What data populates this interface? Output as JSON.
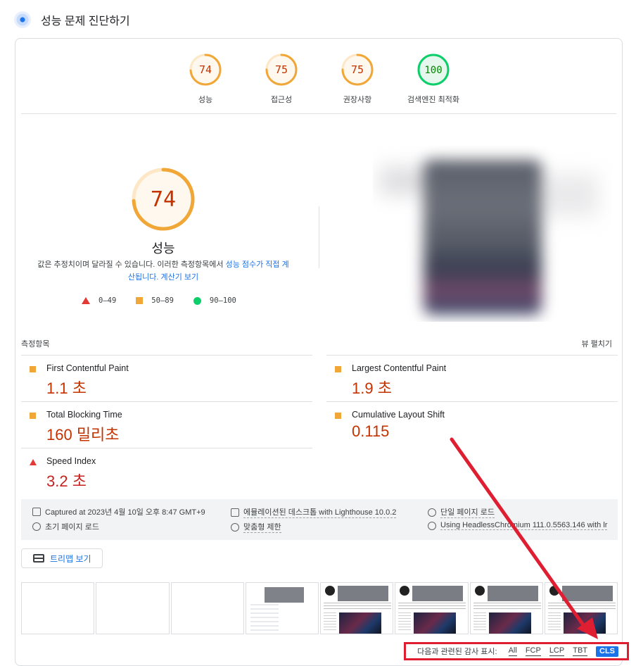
{
  "header": {
    "title": "성능 문제 진단하기",
    "icon": "lighthouse-icon"
  },
  "categories": [
    {
      "score": 74,
      "label": "성능",
      "color": "#f0a737",
      "fill": "#fff8ee",
      "text_color": "#c33300"
    },
    {
      "score": 75,
      "label": "접근성",
      "color": "#f0a737",
      "fill": "#fff8ee",
      "text_color": "#c33300"
    },
    {
      "score": 75,
      "label": "권장사항",
      "color": "#f0a737",
      "fill": "#fff8ee",
      "text_color": "#c33300"
    },
    {
      "score": 100,
      "label": "검색엔진 최적화",
      "color": "#0cce6b",
      "fill": "#e6f7ee",
      "text_color": "#008800"
    }
  ],
  "performance": {
    "score": 74,
    "label": "성능",
    "desc_1": "값은 추정치이며 달라질 수 있습니다. 이러한 측정항목에서 ",
    "desc_link1": "성능 점수가 직접 계산됩니다.",
    "desc_link2": "계산기 보기",
    "legend": [
      {
        "shape": "triangle",
        "range": "0–49"
      },
      {
        "shape": "square",
        "range": "50–89"
      },
      {
        "shape": "circle",
        "range": "90–100"
      }
    ]
  },
  "metrics": {
    "header": "측정항목",
    "expand": "뷰 펼치기",
    "items": [
      {
        "name": "First Contentful Paint",
        "value": "1.1 초",
        "status": "average"
      },
      {
        "name": "Largest Contentful Paint",
        "value": "1.9 초",
        "status": "average"
      },
      {
        "name": "Total Blocking Time",
        "value": "160 밀리초",
        "status": "average"
      },
      {
        "name": "Cumulative Layout Shift",
        "value": "0.115",
        "status": "average"
      },
      {
        "name": "Speed Index",
        "value": "3.2 초",
        "status": "fail"
      }
    ]
  },
  "runtime": {
    "captured": "Captured at 2023년 4월 10일 오후 8:47 GMT+9",
    "initial_load": "초기 페이지 로드",
    "device": "에뮬레이션된 데스크톱 with Lighthouse 10.0.2",
    "throttle": "맞춤형 제한",
    "session": "단일 페이지 로드",
    "browser": "Using HeadlessChromium 111.0.5563.146 with lr"
  },
  "treemap": {
    "label": "트리맵 보기"
  },
  "filter": {
    "label": "다음과 관련된 감사 표시:",
    "options": [
      "All",
      "FCP",
      "LCP",
      "TBT",
      "CLS"
    ],
    "active": "CLS"
  },
  "annotation": {
    "arrow_color": "#e01e32"
  }
}
